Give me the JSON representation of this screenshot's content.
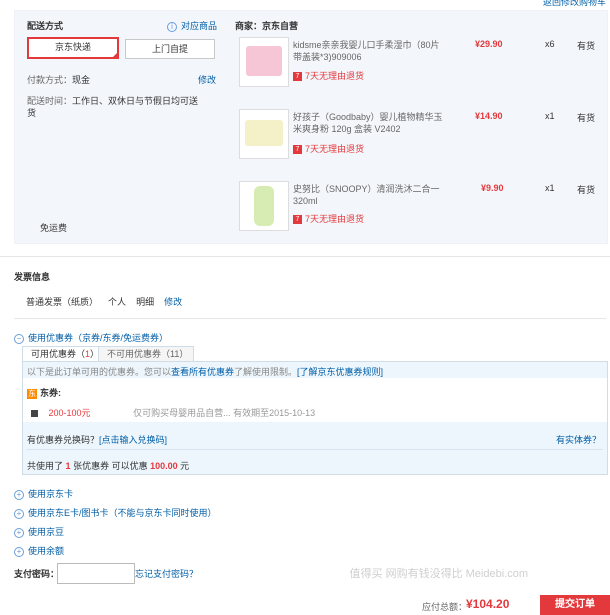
{
  "top": {
    "right_link": "返回修改购物车"
  },
  "delivery": {
    "title": "配送方式",
    "supported_link": "对应商品",
    "options": [
      "京东快递",
      "上门自提"
    ],
    "pay_label": "付款方式：",
    "pay_value": "现金",
    "modify": "修改",
    "time_label": "配送时间：",
    "time_value": "工作日、双休日与节假日均可送货",
    "free_shipping": "免运费"
  },
  "merchant": {
    "label": "商家：京东自营"
  },
  "items": [
    {
      "name": "kidsme亲亲我婴儿口手柔湿巾（80片带盖装*3)909006",
      "price": "¥29.90",
      "qty": "x6",
      "stock": "有货",
      "tag": "7天无理由退货",
      "img_color": "#f6c6d6"
    },
    {
      "name": "好孩子（Goodbaby）婴儿植物精华玉米爽身粉 120g 盒装 V2402",
      "price": "¥14.90",
      "qty": "x1",
      "stock": "有货",
      "tag": "7天无理由退货",
      "img_color": "#f4f0c8"
    },
    {
      "name": "史努比（SNOOPY）清润洗沐二合一 320ml",
      "price": "¥9.90",
      "qty": "x1",
      "stock": "有货",
      "tag": "7天无理由退货",
      "img_color": "#d7ecb2"
    }
  ],
  "invoice": {
    "title": "发票信息",
    "type": "普通发票（纸质）",
    "personal": "个人",
    "detail": "明细",
    "modify": "修改"
  },
  "coupons": {
    "toggle": "使用优惠券（京券/东券/免运费券）",
    "tab_usable": "可用优惠券（",
    "tab_usable_count": "1",
    "tab_usable_close": "）",
    "tab_unusable": "不可用优惠券（11）",
    "notice_prefix": "以下是此订单可用的优惠券。您可以",
    "notice_link1": "查看所有优惠券",
    "notice_mid": "了解使用限制。",
    "notice_link2": "[了解京东优惠券规则]",
    "dong_icon": "东",
    "dong_label": "东券:",
    "coupon_amount": "200-100元",
    "coupon_desc": "仅可购买母婴用品自营...   有效期至2015-10-13",
    "exchange_q": "有优惠券兑换码？",
    "exchange_link": "[点击输入兑换码]",
    "entity": "有实体券？",
    "summary_pre": "共使用了",
    "summary_count": "1",
    "summary_mid": "张优惠券   可以优惠",
    "summary_amount": "100.00",
    "summary_unit": "元"
  },
  "payments": [
    {
      "label": "使用京东卡"
    },
    {
      "label": "使用京东E卡/图书卡（不能与京东卡同时使用）"
    },
    {
      "label": "使用京豆"
    },
    {
      "label": "使用余额"
    }
  ],
  "password": {
    "label": "支付密码：",
    "forgot": "忘记支付密码？"
  },
  "footer": {
    "total_label": "应付总额：",
    "total": "¥104.20",
    "submit": "提交订单"
  },
  "watermark": "值得买  网购有钱没得比  Meidebi.com"
}
